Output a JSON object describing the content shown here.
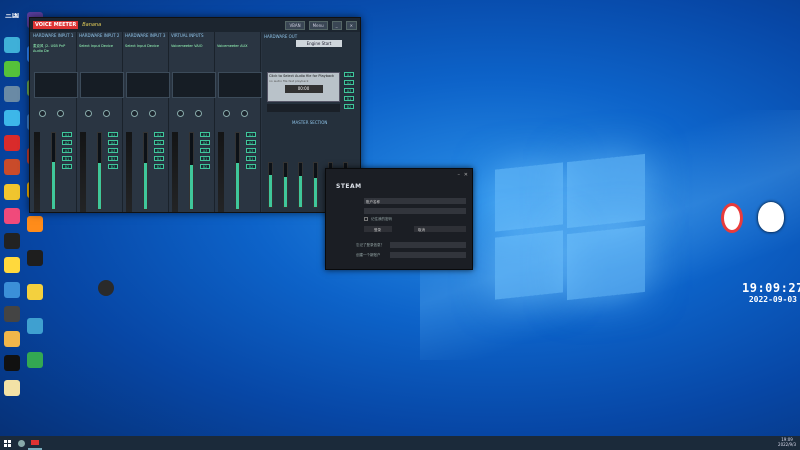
{
  "desktop": {
    "icons_col1": [
      {
        "label": "三国",
        "color": "#1f3f7a"
      },
      {
        "label": "",
        "color": "#3fb0d8"
      },
      {
        "label": "",
        "color": "#55c13a"
      },
      {
        "label": "",
        "color": "#6a8aa5"
      },
      {
        "label": "",
        "color": "#3db7e9"
      },
      {
        "label": "",
        "color": "#d92b2b"
      },
      {
        "label": "",
        "color": "#c94b2a"
      },
      {
        "label": "",
        "color": "#f0c52e"
      },
      {
        "label": "",
        "color": "#f04a7b"
      },
      {
        "label": "",
        "color": "#222"
      },
      {
        "label": "",
        "color": "#ffd93d"
      },
      {
        "label": "",
        "color": "#3b8fd8"
      },
      {
        "label": "",
        "color": "#444"
      },
      {
        "label": "",
        "color": "#f1b64a"
      },
      {
        "label": "",
        "color": "#111"
      },
      {
        "label": "",
        "color": "#f3e2a6"
      }
    ],
    "icons_col2": [
      {
        "label": "",
        "color": "#5b3fa0"
      },
      {
        "label": "",
        "color": "#2e88ff"
      },
      {
        "label": "",
        "color": "#6aa84f"
      },
      {
        "label": "",
        "color": "#3a7fd0"
      },
      {
        "label": "",
        "color": "#c23c2f"
      },
      {
        "label": "",
        "color": "#f4b400"
      },
      {
        "label": "",
        "color": "#ff8c1a"
      },
      {
        "label": "",
        "color": "#1e1e1e"
      },
      {
        "label": "",
        "color": "#f3d03e"
      },
      {
        "label": "",
        "color": "#3fa0d0"
      },
      {
        "label": "",
        "color": "#33a852"
      }
    ]
  },
  "voicemeeter": {
    "title": "VOICE MEETER",
    "brand": "Banana",
    "menu_btn": "Menu",
    "vban_btn": "VBAN",
    "strips": [
      {
        "name": "HARDWARE INPUT 1",
        "tag": "麦克风 (2- USB PnP Audio De"
      },
      {
        "name": "HARDWARE INPUT 2",
        "tag": "Select Input Device"
      },
      {
        "name": "HARDWARE INPUT 3",
        "tag": "Select Input Device"
      },
      {
        "name": "VIRTUAL INPUTS",
        "tag": "Voicemeeter VAIO"
      },
      {
        "name": "",
        "tag": "Voicemeeter AUX"
      }
    ],
    "intellipan": "INTELLIPAN",
    "subtitle_lock": "Color Panel",
    "fader_label": "Fader Gain",
    "solo": "SOLO",
    "mute": "MUTE",
    "buses": [
      "A1",
      "A2",
      "A3",
      "B1",
      "B2"
    ],
    "output_header": "HARDWARE OUT",
    "engine_btn": "Engine Start",
    "cassette_hint": "Click to Select Audio file for Playback",
    "cassette_sub": "no audio file fast playback",
    "time": "00:00",
    "master": "MASTER SECTION",
    "master_buses": [
      "A1",
      "A2",
      "A3",
      "B1",
      "B2"
    ],
    "master_fill": [
      0.72,
      0.68,
      0.7,
      0.66,
      0.7,
      0.69
    ],
    "strip_fill": [
      0.62,
      0.6,
      0.6,
      0.58,
      0.6
    ]
  },
  "steam": {
    "title": "STEAM",
    "username": "账户名称",
    "remember": "记住我的密码",
    "login": "登录",
    "cancel": "取消",
    "forgot": "忘记了登录信息？",
    "create": "创建一个新账户"
  },
  "overlay": {
    "time": "19:09:27",
    "date": "2022-09-03"
  },
  "taskbar": {
    "clock": "19:09",
    "date": "2022/9/3"
  },
  "colors": {
    "accent": "#3fc79b",
    "wallpaper": "#0d63c9"
  }
}
